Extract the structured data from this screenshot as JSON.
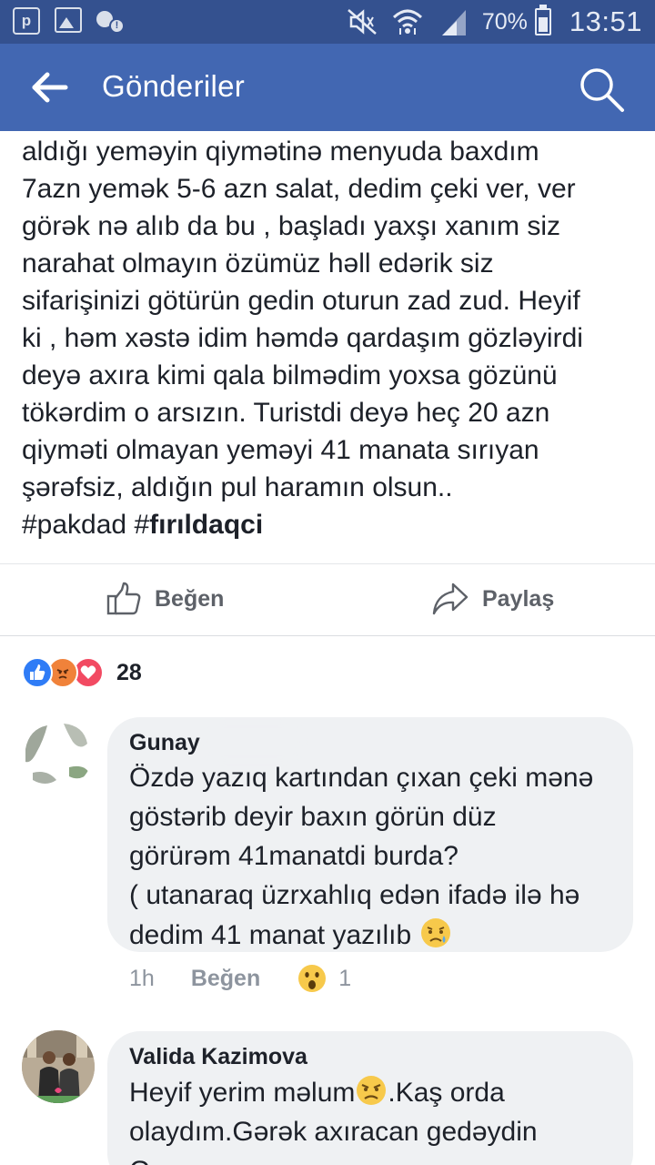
{
  "status_bar": {
    "battery": "70%",
    "time": "13:51",
    "notification_letter": "p"
  },
  "app_bar": {
    "title": "Gönderiler"
  },
  "post": {
    "lines": [
      "aldığı yeməyin qiymətinə menyuda baxdım",
      "7azn yemək 5-6 azn salat, dedim çeki ver, ver",
      "görək nə alıb da bu , başladı yaxşı xanım siz",
      "narahat olmayın özümüz həll edərik siz",
      "sifarişinizi götürün gedin oturun zad zud. Heyif",
      "ki , həm xəstə idim həmdə qardaşım gözləyirdi",
      "deyə axıra kimi qala bilmədim yoxsa gözünü",
      "tökərdim o arsızın. Turistdi deyə heç 20 azn",
      "qiyməti olmayan yeməyi 41 manata sırıyan",
      "şərəfsiz, aldığın pul haramın olsun.."
    ],
    "hashtag1": "#pakdad",
    "hashtag2_prefix": "#",
    "hashtag2_bold": "fırıldaqci"
  },
  "actions": {
    "like_label": "Beğen",
    "share_label": "Paylaş"
  },
  "reactions": {
    "count": "28",
    "types": [
      "like",
      "angry",
      "love"
    ]
  },
  "comments": [
    {
      "author": "Gunay",
      "lines": [
        "Özdə yazıq kartından çıxan çeki mənə",
        "göstərib deyir baxın görün düz",
        "görürəm 41manatdi burda?",
        "( utanaraq üzrxahlıq edən ifadə ilə hə",
        "dedim 41 manat yazılıb"
      ],
      "time": "1h",
      "like_label": "Beğen",
      "reaction_count": "1"
    },
    {
      "author": "Valida Kazimova",
      "line1_a": "Heyif yerim məlum",
      "line1_b": ".Kaş orda",
      "line2": "olaydım.Gərək axıracan gedəydin",
      "line3": "Gunay"
    }
  ],
  "colors": {
    "status_bar": "#34518f",
    "app_bar": "#4267b2",
    "bubble": "#eff1f3",
    "meta_text": "#8d949e"
  }
}
